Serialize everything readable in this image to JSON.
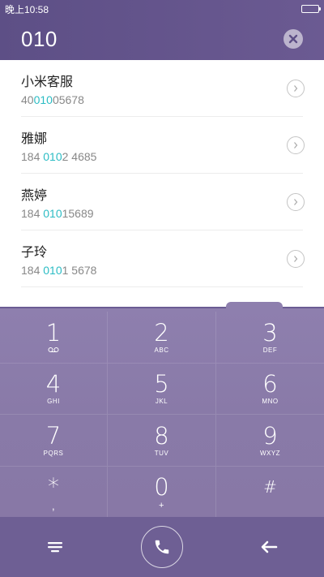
{
  "status": {
    "time": "晚上10:58"
  },
  "dialer": {
    "input": "010"
  },
  "contacts": [
    {
      "name": "小米客服",
      "num_pre": "40",
      "num_hl": "010",
      "num_post": "05678"
    },
    {
      "name": "雅娜",
      "num_pre": "184 ",
      "num_hl": "010",
      "num_post": "2 4685"
    },
    {
      "name": "燕婷",
      "num_pre": "184 ",
      "num_hl": "010",
      "num_post": "15689"
    },
    {
      "name": "子玲",
      "num_pre": "184 ",
      "num_hl": "010",
      "num_post": "1 5678"
    }
  ],
  "keypad": [
    {
      "digit": "1",
      "sub": "voicemail-icon"
    },
    {
      "digit": "2",
      "sub": "ABC"
    },
    {
      "digit": "3",
      "sub": "DEF"
    },
    {
      "digit": "4",
      "sub": "GHI"
    },
    {
      "digit": "5",
      "sub": "JKL"
    },
    {
      "digit": "6",
      "sub": "MNO"
    },
    {
      "digit": "7",
      "sub": "PQRS"
    },
    {
      "digit": "8",
      "sub": "TUV"
    },
    {
      "digit": "9",
      "sub": "WXYZ"
    },
    {
      "digit": "*",
      "sub": ","
    },
    {
      "digit": "0",
      "sub": "+"
    },
    {
      "digit": "#",
      "sub": ""
    }
  ],
  "colors": {
    "accent": "#2bbcc4",
    "header": "#5d4f86",
    "pad": "#8e7fae",
    "bottom": "#6e5f94"
  }
}
